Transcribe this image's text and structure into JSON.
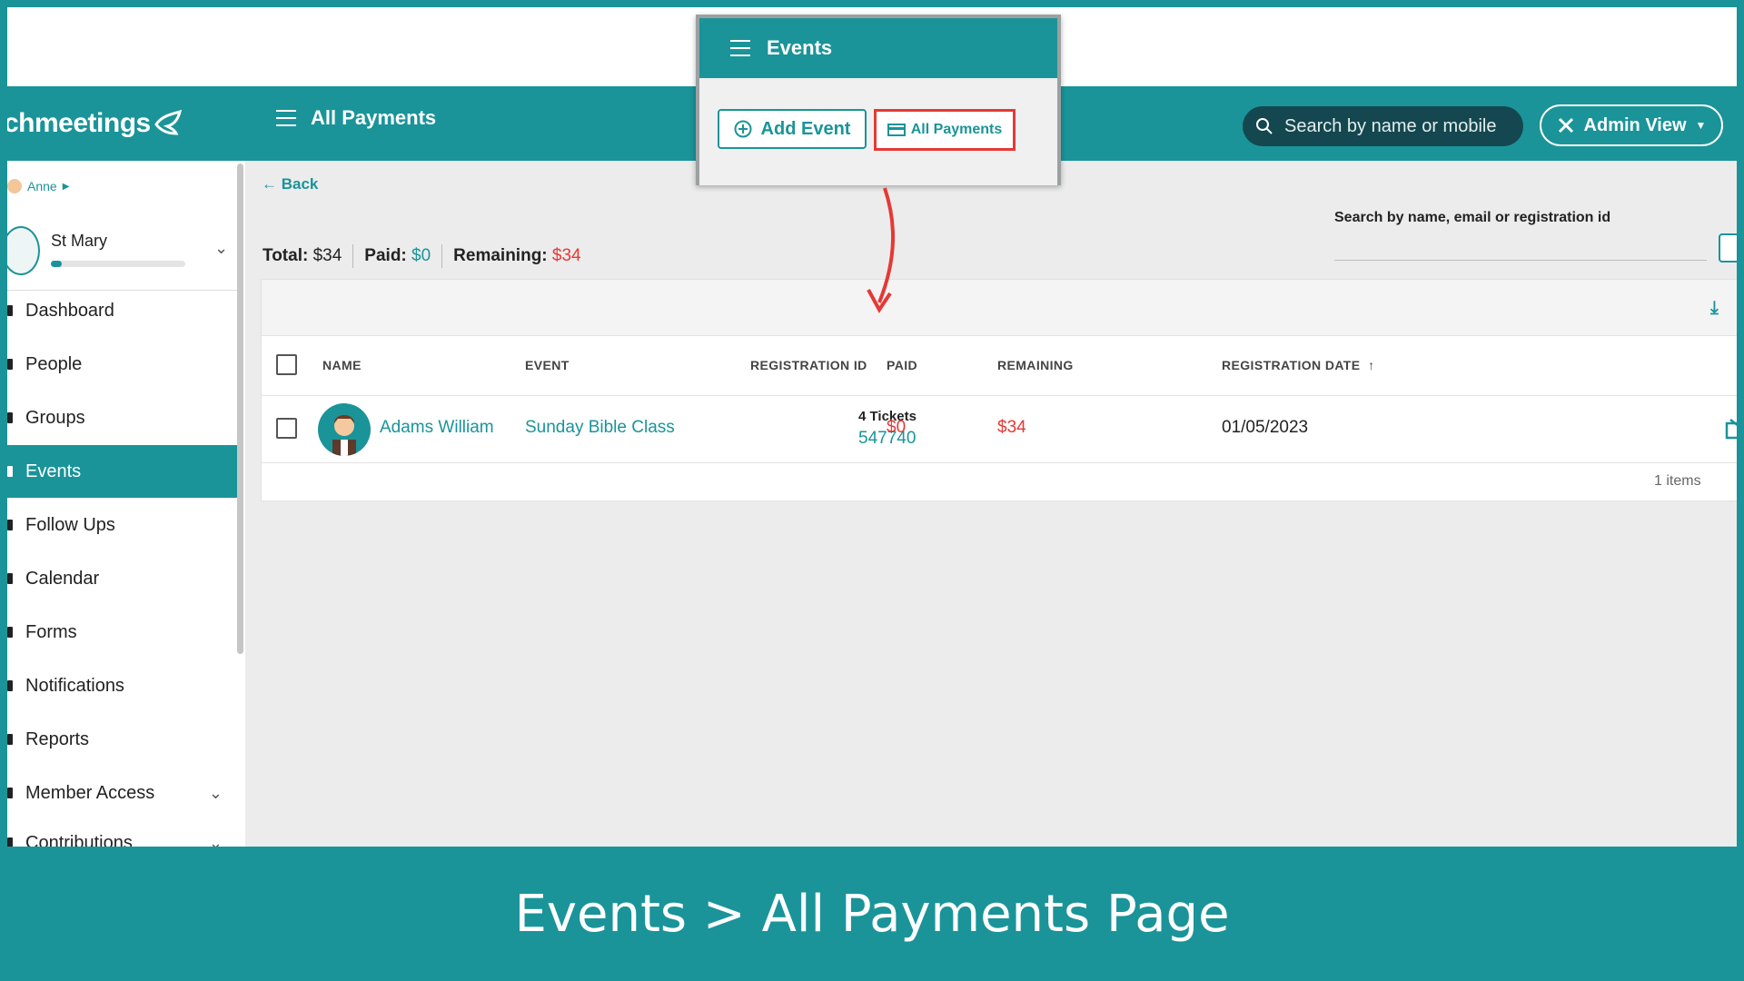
{
  "app": {
    "logo_text": "chmeetings",
    "page_title": "All Payments"
  },
  "header": {
    "search_placeholder": "Search by name or mobile",
    "admin_view_label": "Admin View"
  },
  "sidebar": {
    "user_name": "Anne",
    "church_name": "St Mary",
    "church_progress": 0.08,
    "items": [
      {
        "label": "Dashboard",
        "active": false
      },
      {
        "label": "People",
        "active": false
      },
      {
        "label": "Groups",
        "active": false
      },
      {
        "label": "Events",
        "active": true
      },
      {
        "label": "Follow Ups",
        "active": false
      },
      {
        "label": "Calendar",
        "active": false
      },
      {
        "label": "Forms",
        "active": false
      },
      {
        "label": "Notifications",
        "active": false
      },
      {
        "label": "Reports",
        "active": false
      },
      {
        "label": "Member Access",
        "active": false
      },
      {
        "label": "Contributions",
        "active": false
      }
    ]
  },
  "main": {
    "back_label": "Back",
    "totals": {
      "total_label": "Total:",
      "total_value": "$34",
      "paid_label": "Paid:",
      "paid_value": "$0",
      "remaining_label": "Remaining:",
      "remaining_value": "$34"
    },
    "search_label": "Search by name, email or registration id",
    "table": {
      "columns": [
        "NAME",
        "EVENT",
        "REGISTRATION ID",
        "PAID",
        "REMAINING",
        "REGISTRATION DATE"
      ],
      "rows": [
        {
          "name": "Adams William",
          "event": "Sunday Bible Class",
          "tickets": "4 Tickets",
          "registration_id": "547740",
          "paid": "$0",
          "remaining": "$34",
          "registration_date": "01/05/2023"
        }
      ],
      "items_count": "1 items"
    }
  },
  "popup": {
    "title": "Events",
    "add_event_label": "Add Event",
    "all_payments_label": "All Payments"
  },
  "caption": "Events > All Payments Page",
  "colors": {
    "brand": "#1a9499",
    "accent_red": "#e53935",
    "dark_search": "#14474f"
  }
}
